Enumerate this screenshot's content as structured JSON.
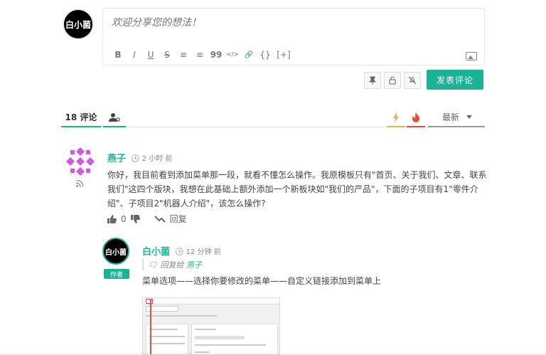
{
  "composer": {
    "avatar_text": "白小菌",
    "placeholder": "欢迎分享您的想法！",
    "toolbar": [
      "B",
      "I",
      "U",
      "S",
      "≡",
      "≡",
      "99",
      "</>",
      "🔗",
      "{}",
      "[+]"
    ],
    "submit_label": "发表评论"
  },
  "tabs": {
    "count_label": "18 评论",
    "sort_label": "最新"
  },
  "comments": [
    {
      "author": "燕子",
      "time": "2 小时 前",
      "text": "你好，我目前看到添加菜单那一段，就看不懂怎么操作。我原模板只有\"首页、关于我们、文章、联系我们\"这四个版块，我想在此基础上额外添加一个新板块如\"我们的产品\"，下面的子项目有1\"零件介绍\"、子项目2\"机器人介绍\"，该怎么操作?",
      "likes": "0",
      "reply_label": "回复"
    },
    {
      "avatar_text": "白小菌",
      "author": "白小菌",
      "badge": "作者",
      "time": "12 分钟 前",
      "reply_prefix": "回复给",
      "reply_to": "燕子",
      "text": "菜单选项——选择你要修改的菜单——自定义链接添加到菜单上"
    }
  ],
  "colors": {
    "accent": "#1bb394",
    "hot": "#f0ad4e",
    "fire": "#e74c3c"
  }
}
